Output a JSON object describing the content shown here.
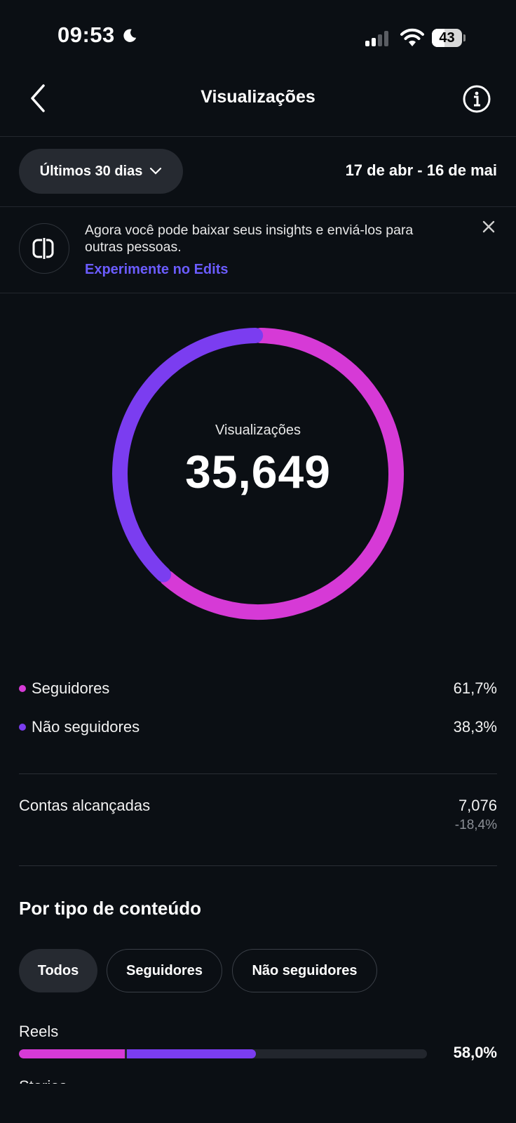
{
  "status_bar": {
    "time": "09:53",
    "battery": "43"
  },
  "header": {
    "title": "Visualizações"
  },
  "filter": {
    "range_label": "Últimos 30 dias",
    "date_range": "17 de abr - 16 de mai"
  },
  "banner": {
    "text": "Agora você pode baixar seus insights e enviá-los para outras pessoas.",
    "link": "Experimente no Edits"
  },
  "summary": {
    "label": "Visualizações",
    "value": "35,649"
  },
  "breakdown": [
    {
      "label": "Seguidores",
      "value": "61,7%",
      "color": "#d63ad6",
      "fraction": 0.617
    },
    {
      "label": "Não seguidores",
      "value": "38,3%",
      "color": "#7b3df0",
      "fraction": 0.383
    }
  ],
  "reach": {
    "label": "Contas alcançadas",
    "value": "7,076",
    "change": "-18,4%"
  },
  "content_type": {
    "title": "Por tipo de conteúdo",
    "chips": [
      "Todos",
      "Seguidores",
      "Não seguidores"
    ],
    "active_chip": "Todos",
    "rows": [
      {
        "label": "Reels",
        "percent": "58,0%",
        "followers_fraction": 0.26,
        "nonfollowers_fraction": 0.32
      },
      {
        "label": "Stories"
      }
    ]
  },
  "colors": {
    "followers": "#d63ad6",
    "nonfollowers": "#7b3df0",
    "link": "#6b5cff",
    "background": "#0b0f14"
  }
}
